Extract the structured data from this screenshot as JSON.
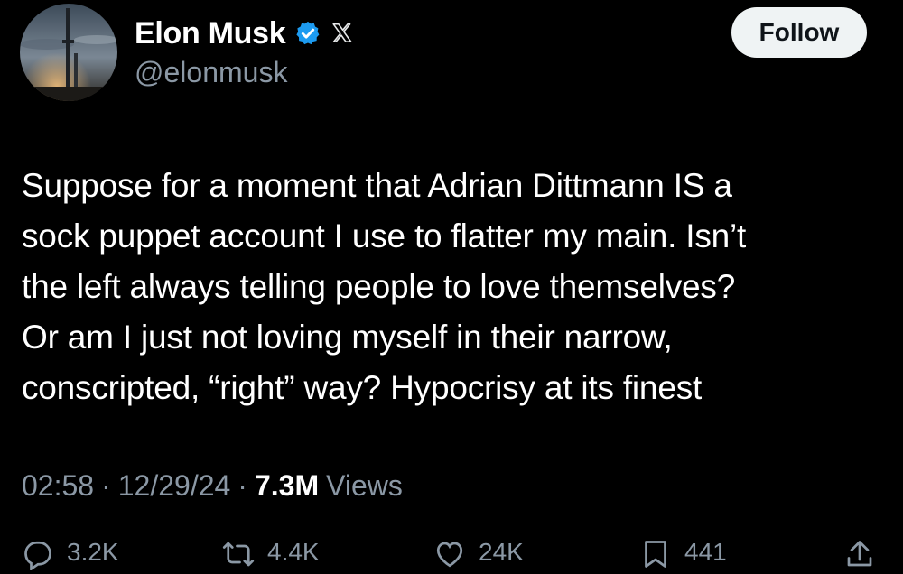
{
  "author": {
    "display_name": "Elon Musk",
    "handle": "@elonmusk",
    "verified": true,
    "avatar_icon": "avatar-rocket-launch-image"
  },
  "follow_button": {
    "label": "Follow"
  },
  "tweet": {
    "lines": [
      "Suppose for a moment that Adrian Dittmann IS a",
      "sock puppet account I use to flatter my main. Isn’t",
      "the left always telling people to love themselves?",
      "Or am I just not loving myself in their narrow,",
      "conscripted, “right” way? Hypocrisy at its finest"
    ]
  },
  "meta": {
    "time": "02:58",
    "separator": "·",
    "date": "12/29/24",
    "views_count": "7.3M",
    "views_label": "Views"
  },
  "actions": {
    "replies": "3.2K",
    "reposts": "4.4K",
    "likes": "24K",
    "bookmarks": "441"
  },
  "colors": {
    "background": "#000000",
    "text": "#ffffff",
    "secondary_text": "#8b98a5",
    "verified_badge": "#1d9bf0",
    "follow_button_bg": "#eff3f4"
  }
}
